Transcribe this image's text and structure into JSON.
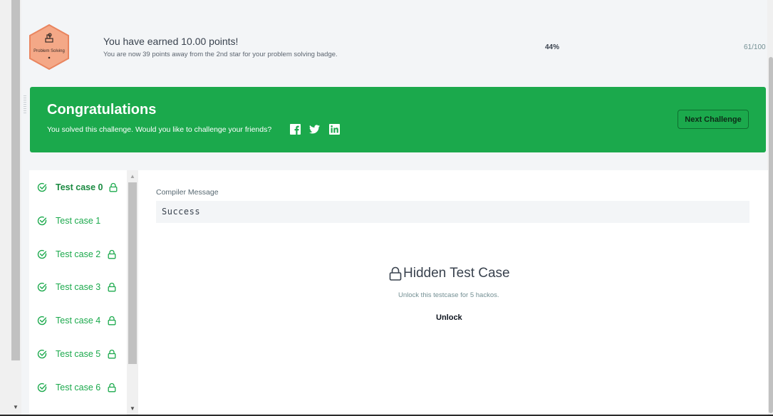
{
  "badge": {
    "name": "Problem Solving",
    "colors": {
      "fill": "#f4a887",
      "stroke": "#e9855f"
    }
  },
  "progress": {
    "earned_text": "You have earned 10.00 points!",
    "next_star_text": "You are now 39 points away from the 2nd star for your problem solving badge.",
    "percent_text": "44%",
    "percent_value": 44,
    "points_text": "61/100"
  },
  "congrats": {
    "title": "Congratulations",
    "subtitle": "You solved this challenge. Would you like to challenge your friends?",
    "share_icons": [
      "facebook-icon",
      "twitter-icon",
      "linkedin-icon"
    ],
    "next_button": "Next Challenge",
    "colors": {
      "background": "#1ba94c"
    }
  },
  "test_cases": [
    {
      "label": "Test case 0",
      "passed": true,
      "locked": true,
      "active": true
    },
    {
      "label": "Test case 1",
      "passed": true,
      "locked": false,
      "active": false
    },
    {
      "label": "Test case 2",
      "passed": true,
      "locked": true,
      "active": false
    },
    {
      "label": "Test case 3",
      "passed": true,
      "locked": true,
      "active": false
    },
    {
      "label": "Test case 4",
      "passed": true,
      "locked": true,
      "active": false
    },
    {
      "label": "Test case 5",
      "passed": true,
      "locked": true,
      "active": false
    },
    {
      "label": "Test case 6",
      "passed": true,
      "locked": true,
      "active": false
    }
  ],
  "result": {
    "compiler_label": "Compiler Message",
    "compiler_message": "Success",
    "hidden_title": "Hidden Test Case",
    "hidden_subtitle": "Unlock this testcase for 5 hackos.",
    "unlock_button": "Unlock"
  }
}
